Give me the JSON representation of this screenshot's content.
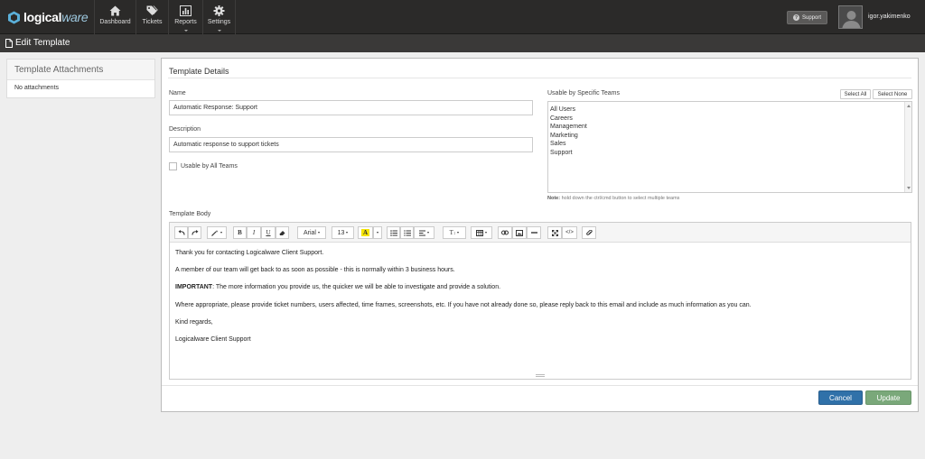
{
  "brand": {
    "name_part1": "logical",
    "name_part2": "ware"
  },
  "nav": [
    {
      "label": "Dashboard",
      "icon": "home-icon"
    },
    {
      "label": "Tickets",
      "icon": "tags-icon"
    },
    {
      "label": "Reports",
      "icon": "bar-chart-icon"
    },
    {
      "label": "Settings",
      "icon": "gear-icon"
    }
  ],
  "header": {
    "support_label": "Support",
    "username": "igor.yakimenko"
  },
  "page": {
    "title": "Edit Template"
  },
  "attachments": {
    "title": "Template Attachments",
    "empty_text": "No attachments"
  },
  "details": {
    "title": "Template Details",
    "name_label": "Name",
    "name_value": "Automatic Response: Support",
    "description_label": "Description",
    "description_value": "Automatic response to support tickets",
    "all_teams_label": "Usable by All Teams",
    "teams_label": "Usable by Specific Teams",
    "select_all_label": "Select All",
    "select_none_label": "Select None",
    "teams": [
      "All Users",
      "Careers",
      "Management",
      "Marketing",
      "Sales",
      "Support"
    ],
    "note_bold": "Note:",
    "note_text": " hold down the ctrl/cmd button to select multiple teams",
    "body_label": "Template Body"
  },
  "editor": {
    "font_name": "Arial",
    "font_size": "13",
    "highlight_letter": "A",
    "style_letter": "T",
    "paragraphs": {
      "p1": "Thank you for contacting Logicalware Client Support.",
      "p2": "A member of our team will get back to as soon as possible - this is normally within 3 business hours.",
      "p3_bold": "IMPORTANT",
      "p3_text": ": The more information you provide us, the quicker we will be able to investigate and provide a solution.",
      "p4": "Where appropriate, please provide ticket numbers, users affected, time frames, screenshots, etc. If you have not already done so, please reply back to this email and include as much information as you can.",
      "p5": "Kind regards,",
      "p6": "Logicalware Client Support"
    }
  },
  "actions": {
    "cancel_label": "Cancel",
    "update_label": "Update"
  },
  "colors": {
    "topbar": "#2b2a29",
    "cancel": "#3071a9",
    "update": "#7aa87a",
    "highlight": "#f5e400"
  }
}
